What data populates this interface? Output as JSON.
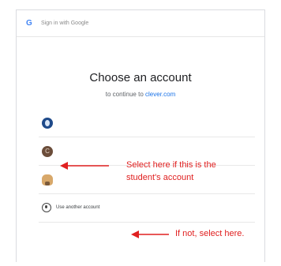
{
  "header": {
    "title": "Sign in with Google",
    "logo_letter": "G"
  },
  "main": {
    "heading": "Choose an account",
    "subtitle_prefix": "to continue to",
    "subtitle_link": "clever.com"
  },
  "accounts": [
    {
      "avatar": "blue-account-avatar"
    },
    {
      "avatar": "brown-account-avatar",
      "initial": "C"
    },
    {
      "avatar": "cartoon-account-avatar"
    }
  ],
  "use_another": {
    "label": "Use another account",
    "icon": "person-circle-icon"
  },
  "annotations": {
    "select_line1": "Select here if this is the",
    "select_line2": "student's account",
    "if_not": "If not, select here."
  },
  "colors": {
    "annotation": "#e02020",
    "link": "#1a73e8"
  }
}
